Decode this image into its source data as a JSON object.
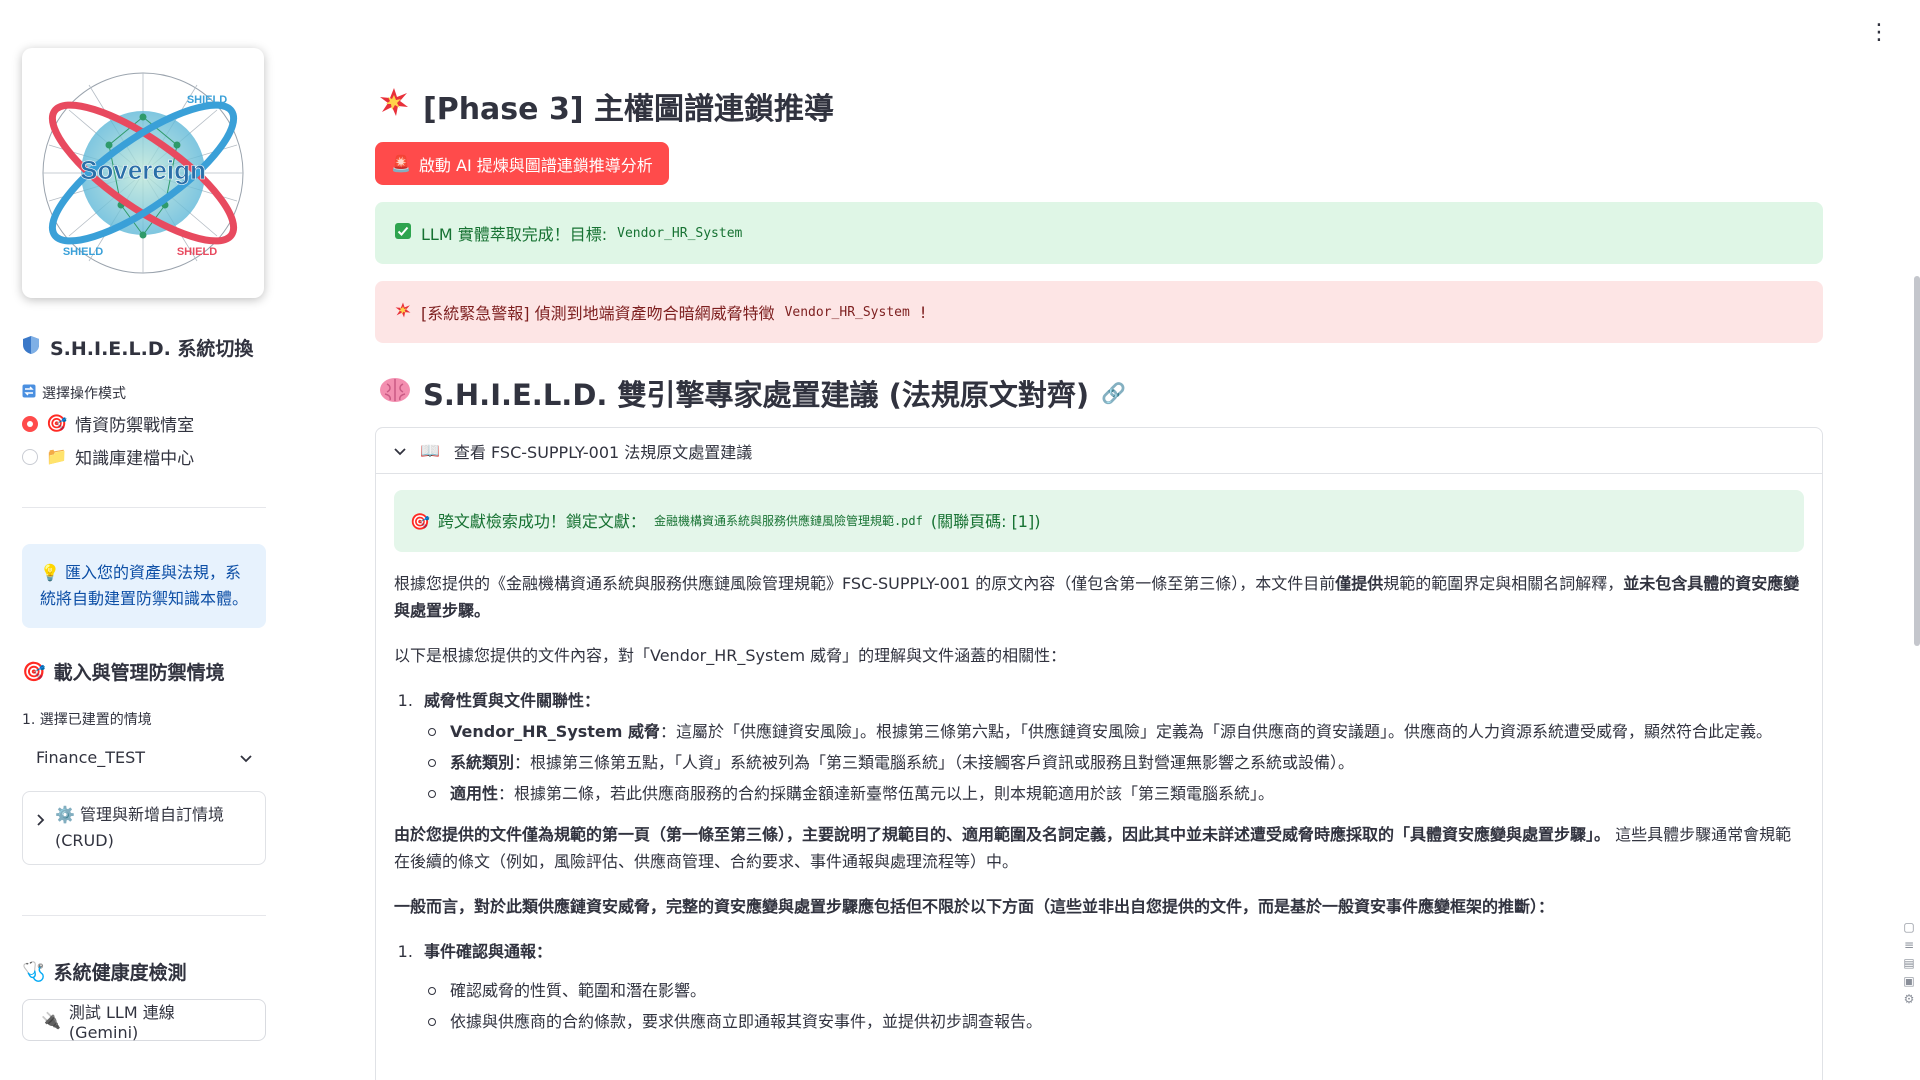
{
  "sidebar": {
    "system_switch_title": "S.H.I.E.L.D. 系統切換",
    "mode_label": "選擇操作模式",
    "modes": [
      {
        "label": "情資防禦戰情室",
        "selected": true
      },
      {
        "label": "知識庫建檔中心",
        "selected": false
      }
    ],
    "info_text": "匯入您的資產與法規，系統將自動建置防禦知識本體。",
    "scenario_title": "載入與管理防禦情境",
    "scenario_select_label": "1. 選擇已建置的情境",
    "scenario_selected": "Finance_TEST",
    "crud_expander": "管理與新增自訂情境 (CRUD)",
    "health_title": "系統健康度檢測",
    "test_llm_button": "測試 LLM 連線 (Gemini)",
    "logo_text": "Sovereign",
    "logo_ring_text": "SHIELD"
  },
  "main": {
    "phase_title": "[Phase 3] 主權圖譜連鎖推導",
    "run_button": "啟動 AI 提煉與圖譜連鎖推導分析",
    "success_prefix": "LLM 實體萃取完成！目標:",
    "success_target": "Vendor_HR_System",
    "alert_prefix": "[系統緊急警報] 偵測到地端資產吻合暗網威脅特徵",
    "alert_target": "Vendor_HR_System",
    "alert_suffix": "!",
    "section_title": "S.H.I.E.L.D. 雙引擎專家處置建議 (法規原文對齊)",
    "expander_title": "查看 FSC-SUPPLY-001 法規原文處置建議",
    "retrieval_prefix": "跨文獻檢索成功！鎖定文獻：",
    "retrieval_file": "金融機構資通系統與服務供應鏈風險管理規範.pdf",
    "retrieval_pages": "(關聯頁碼: [1])",
    "para1_plain": "根據您提供的《金融機構資通系統與服務供應鏈風險管理規範》FSC-SUPPLY-001 的原文內容（僅包含第一條至第三條），本文件目前",
    "para1_bold_a": "僅提供",
    "para1_mid": "規範的範圍界定與相關名詞解釋，",
    "para1_bold_b": "並未包含具體的資安應變與處置步驟。",
    "para2": "以下是根據您提供的文件內容，對「Vendor_HR_System 威脅」的理解與文件涵蓋的相關性：",
    "list1_title": "威脅性質與文件關聯性：",
    "list1_items": [
      {
        "bold": "Vendor_HR_System 威脅",
        "text": "：這屬於「供應鏈資安風險」。根據第三條第六點，「供應鏈資安風險」定義為「源自供應商的資安議題」。供應商的人力資源系統遭受威脅，顯然符合此定義。"
      },
      {
        "bold": "系統類別",
        "text": "：根據第三條第五點，「人資」系統被列為「第三類電腦系統」（未接觸客戶資訊或服務且對營運無影響之系統或設備）。"
      },
      {
        "bold": "適用性",
        "text": "：根據第二條，若此供應商服務的合約採購金額達新臺幣伍萬元以上，則本規範適用於該「第三類電腦系統」。"
      }
    ],
    "para3_bold": "由於您提供的文件僅為規範的第一頁（第一條至第三條），主要說明了規範目的、適用範圍及名詞定義，因此其中並未詳述遭受威脅時應採取的「具體資安應變與處置步驟」。",
    "para3_plain": " 這些具體步驟通常會規範在後續的條文（例如，風險評估、供應商管理、合約要求、事件通報與處理流程等）中。",
    "para4_bold": "一般而言，對於此類供應鏈資安威脅，完整的資安應變與處置步驟應包括但不限於以下方面（這些並非出自您提供的文件，而是基於一般資安事件應變框架的推斷）：",
    "list2_title": "事件確認與通報：",
    "list2_items": [
      "確認威脅的性質、範圍和潛在影響。",
      "依據與供應商的合約條款，要求供應商立即通報其資安事件，並提供初步調查報告。"
    ]
  },
  "colors": {
    "primary": "#ff4b4b",
    "success_bg": "#dff6e6",
    "error_bg": "#fde5e5",
    "info_bg": "#e7f2fd"
  },
  "icons": [
    "shield-icon",
    "swap-icon",
    "target-icon",
    "folder-icon",
    "bulb-icon",
    "gear-icon",
    "stethoscope-icon",
    "plug-icon",
    "explosion-icon",
    "siren-icon",
    "check-icon",
    "brain-icon",
    "book-icon",
    "link-icon",
    "kebab-icon"
  ]
}
